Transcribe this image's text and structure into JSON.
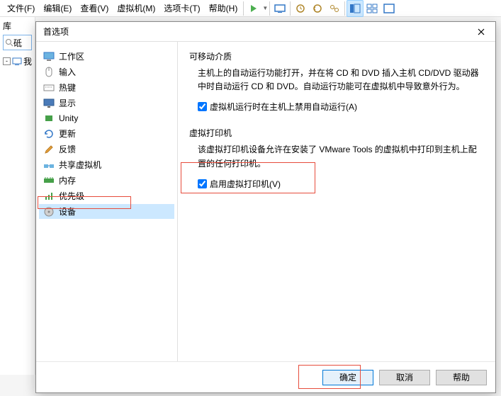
{
  "menubar": {
    "file": "文件(F)",
    "edit": "编辑(E)",
    "view": "查看(V)",
    "vm": "虚拟机(M)",
    "tabs": "选项卡(T)",
    "help": "帮助(H)"
  },
  "library": {
    "label": "库",
    "search_placeholder": "砥",
    "tree_item": "我"
  },
  "dialog": {
    "title": "首选项",
    "sidebar": {
      "workspace": "工作区",
      "input": "输入",
      "hotkeys": "热键",
      "display": "显示",
      "unity": "Unity",
      "updates": "更新",
      "feedback": "反馈",
      "shared_vms": "共享虚拟机",
      "memory": "内存",
      "priority": "优先级",
      "devices": "设备"
    },
    "content": {
      "removable_section": "可移动介质",
      "removable_desc": "主机上的自动运行功能打开，并在将 CD 和 DVD 插入主机 CD/DVD 驱动器中时自动运行 CD 和 DVD。自动运行功能可在虚拟机中导致意外行为。",
      "removable_checkbox": "虚拟机运行时在主机上禁用自动运行(A)",
      "printer_section": "虚拟打印机",
      "printer_desc": "该虚拟打印机设备允许在安装了 VMware Tools 的虚拟机中打印到主机上配置的任何打印机。",
      "printer_checkbox": "启用虚拟打印机(V)"
    },
    "buttons": {
      "ok": "确定",
      "cancel": "取消",
      "help": "帮助"
    }
  }
}
